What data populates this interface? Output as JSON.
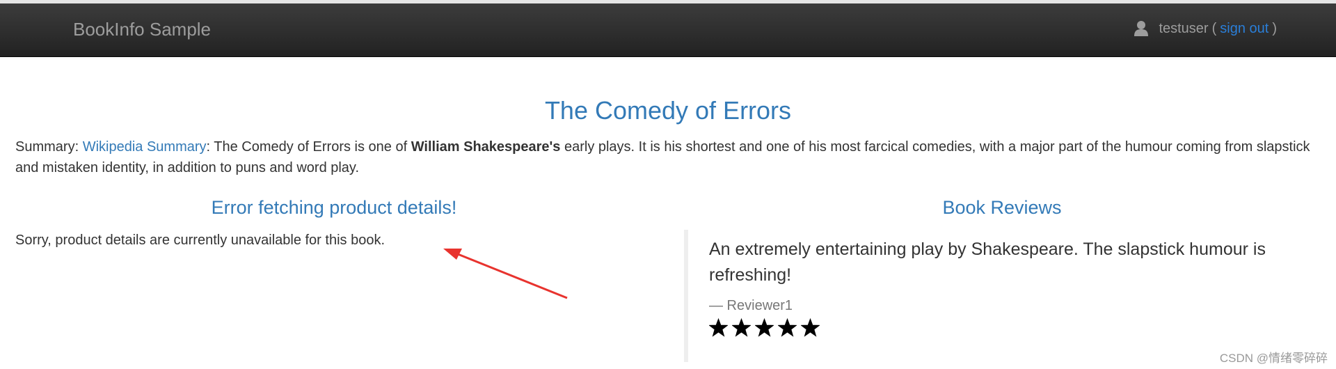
{
  "navbar": {
    "brand": "BookInfo Sample",
    "username": "testuser",
    "open_paren": "(",
    "sign_out": "sign out",
    "close_paren": ")"
  },
  "book": {
    "title": "The Comedy of Errors",
    "summary_prefix": "Summary: ",
    "summary_link": "Wikipedia Summary",
    "summary_part1": ": The Comedy of Errors is one of ",
    "summary_bold": "William Shakespeare's",
    "summary_part2": " early plays. It is his shortest and one of his most farcical comedies, with a major part of the humour coming from slapstick and mistaken identity, in addition to puns and word play."
  },
  "details": {
    "heading": "Error fetching product details!",
    "message": "Sorry, product details are currently unavailable for this book."
  },
  "reviews": {
    "heading": "Book Reviews",
    "items": [
      {
        "text": "An extremely entertaining play by Shakespeare. The slapstick humour is refreshing!",
        "reviewer": "— Reviewer1",
        "rating": 5,
        "max_rating": 5
      }
    ]
  },
  "annotation": {
    "arrow_color": "#e8332e"
  },
  "watermark": "CSDN @情绪零碎碎",
  "colors": {
    "link": "#337ab7",
    "signout": "#2a7ed8",
    "nav_text": "#9d9d9d",
    "nav_bg": "#222222"
  }
}
